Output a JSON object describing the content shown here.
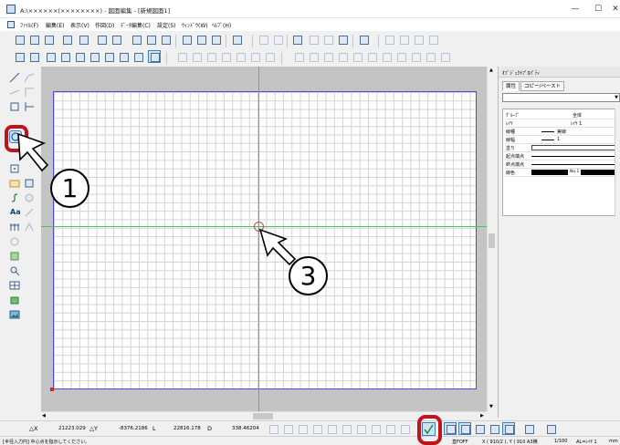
{
  "window": {
    "title": "A:\\××××××(××××××××) - 図面編集 - [新規図面1]",
    "minimize_glyph": "—",
    "maximize_glyph": "☐",
    "close_glyph": "✕"
  },
  "menu": {
    "items": [
      "ﾌｧｲﾙ(F)",
      "編集(E)",
      "表示(V)",
      "作図(D)",
      "ﾃﾞｰﾀ編集(C)",
      "設定(S)",
      "ｳｨﾝﾄﾞｳ(W)",
      "ﾍﾙﾌﾟ(H)"
    ]
  },
  "left_toolbar": {
    "text_tool_glyph": "Aa",
    "highlighted_tool": "circle-tool"
  },
  "right_panel": {
    "title": "ｵﾌﾞｼﾞｪｸﾄﾌﾟﾛﾊﾟﾃｨ",
    "tabs": [
      "属性",
      "コピー/ペースト"
    ],
    "table_header": {
      "key": "ｸﾞﾙｰﾌﾟ",
      "value": "全体"
    },
    "rows": [
      {
        "key": "ﾚｲﾔ",
        "value": "ﾚｲﾔ 1"
      },
      {
        "key": "線種",
        "value": "実線"
      },
      {
        "key": "線幅",
        "value": "1"
      },
      {
        "key": "塗り",
        "value": ""
      },
      {
        "key": "起点端点",
        "value": ""
      },
      {
        "key": "終点端点",
        "value": ""
      },
      {
        "key": "線色",
        "value": "No.1"
      }
    ],
    "line_color": "#000000"
  },
  "coordinates": {
    "dx_label": "△X",
    "dx_value": "21223.029",
    "dy_label": "△Y",
    "dy_value": "-8376.2186",
    "l_label": "L",
    "l_value": "22816.178",
    "d_label": "D",
    "d_value": "338.46204"
  },
  "status": {
    "message": "[半径入力円]  中心点を指示してください。",
    "snap": "直FOFF",
    "paper": "X ( 910/2 ), Y ( 910  A3横",
    "scale": "1/100",
    "layer": "AL=ﾚｲﾔ 1",
    "unit": "mm"
  },
  "callouts": [
    "1",
    "3"
  ],
  "colors": {
    "highlight_ring": "#c0141c",
    "paper_border": "#4b4bd6",
    "axis_line": "#4cc44c",
    "grid": "#d3d3d3",
    "canvas_bg": "#c4c4c4",
    "active_tool_bg": "#cfe3f7"
  },
  "icons": {
    "app": "app-icon",
    "circle_tool": "circle-tool-icon",
    "cursor": "crosshair-cursor-icon",
    "snap": "snap-check-icon"
  }
}
